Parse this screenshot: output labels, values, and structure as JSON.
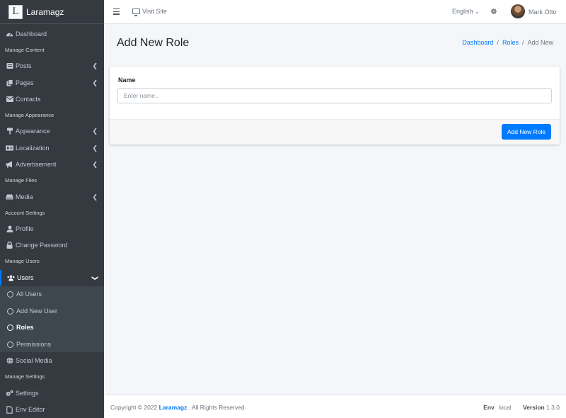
{
  "brand": {
    "logo_letter": "L",
    "name": "Laramagz"
  },
  "sidebar": {
    "dashboard": "Dashboard",
    "headers": [
      "Manage Content",
      "Manage Appearance",
      "Manage Files",
      "Account Settings",
      "Manage Users",
      "Manage Settings"
    ],
    "posts": "Posts",
    "pages": "Pages",
    "contacts": "Contacts",
    "appearance": "Appearance",
    "localization": "Localization",
    "advertisement": "Advertisement",
    "media": "Media",
    "profile": "Profile",
    "change_password": "Change Password",
    "users": "Users",
    "users_sub": [
      "All Users",
      "Add New User",
      "Roles",
      "Permissions"
    ],
    "social_media": "Social Media",
    "settings": "Settings",
    "env_editor": "Env Editor"
  },
  "topbar": {
    "visit_site": "Visit Site",
    "language": "English",
    "user_name": "Mark Otto"
  },
  "page": {
    "title": "Add New Role",
    "breadcrumb": [
      "Dashboard",
      "Roles",
      "Add New"
    ]
  },
  "form": {
    "name_label": "Name",
    "name_placeholder": "Enter name..",
    "submit_label": "Add New Role"
  },
  "footer": {
    "copyright_prefix": "Copyright © 2022",
    "brand": "Laramagz",
    "copyright_suffix": ". All Rights Reserved",
    "env_label": "Env",
    "env_value": "local",
    "version_label": "Version",
    "version_value": "1.3.0"
  },
  "colors": {
    "primary": "#007bff",
    "sidebar": "#343a40"
  }
}
